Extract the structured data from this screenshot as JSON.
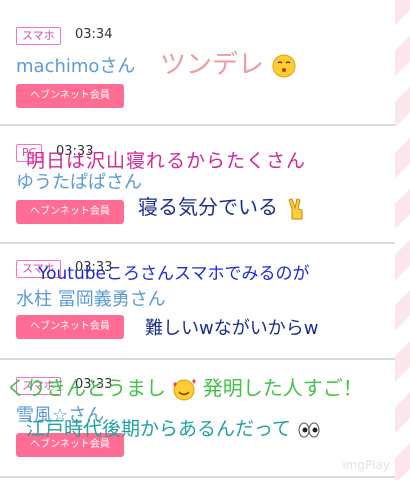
{
  "posts": [
    {
      "device": "スマホ",
      "time": "03:34",
      "user": "machimoさん",
      "button_label": "ヘブンネット会員"
    },
    {
      "device": "PC",
      "time": "03:33",
      "user": "ゆうたぱぱさん",
      "button_label": "ヘブンネット会員"
    },
    {
      "device": "スマホ",
      "time": "03:33",
      "user": "水柱 冨岡義勇さん",
      "button_label": "ヘブンネット会員"
    },
    {
      "device": "スマホ",
      "time": "03:33",
      "user": "雪風☆さん",
      "button_label": "ヘブンネット会員"
    }
  ],
  "overlays": {
    "t1": "ツンデレ",
    "t2": "明日は沢山寝れるからたくさん",
    "t3": "寝る気分でいる",
    "t4": "Youtubeころさんスマホでみるのが",
    "t5": "難しいwながいからw",
    "t6": "くりきんとうまし",
    "t7": "発明した人すご！",
    "t8": "江戸時代後期からあるんだって"
  },
  "watermark": "imgPlay",
  "icons": [
    "kiss-emoji-icon",
    "victory-hand-icon",
    "smiling-hearts-icon",
    "eyes-icon"
  ],
  "colors": {
    "badge_border": "#ff6ec4",
    "username": "#5b9bd5",
    "member_button": "#ff6d94"
  }
}
